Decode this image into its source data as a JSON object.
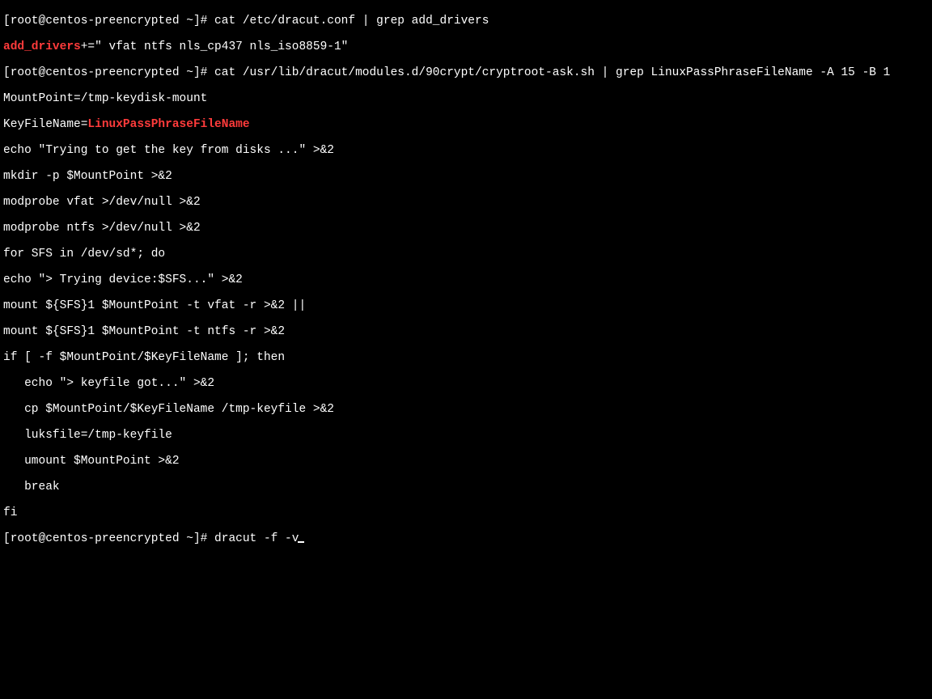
{
  "prompt": "[root@centos-preencrypted ~]# ",
  "cmd1": "cat /etc/dracut.conf | grep add_drivers",
  "line2a": "add_drivers",
  "line2b": "+=\" vfat ntfs nls_cp437 nls_iso8859-1\"",
  "cmd2": "cat /usr/lib/dracut/modules.d/90crypt/cryptroot-ask.sh | grep LinuxPassPhraseFileName -A 15 -B 1",
  "l4": "MountPoint=/tmp-keydisk-mount",
  "l5a": "KeyFileName=",
  "l5b": "LinuxPassPhraseFileName",
  "l6": "echo \"Trying to get the key from disks ...\" >&2",
  "l7": "mkdir -p $MountPoint >&2",
  "l8": "modprobe vfat >/dev/null >&2",
  "l9": "modprobe ntfs >/dev/null >&2",
  "l10": "for SFS in /dev/sd*; do",
  "l11": "echo \"> Trying device:$SFS...\" >&2",
  "l12": "mount ${SFS}1 $MountPoint -t vfat -r >&2 ||",
  "l13": "mount ${SFS}1 $MountPoint -t ntfs -r >&2",
  "l14": "if [ -f $MountPoint/$KeyFileName ]; then",
  "l15": "   echo \"> keyfile got...\" >&2",
  "l16": "   cp $MountPoint/$KeyFileName /tmp-keyfile >&2",
  "l17": "   luksfile=/tmp-keyfile",
  "l18": "   umount $MountPoint >&2",
  "l19": "   break",
  "l20": "fi",
  "cmd3": "dracut -f -v"
}
